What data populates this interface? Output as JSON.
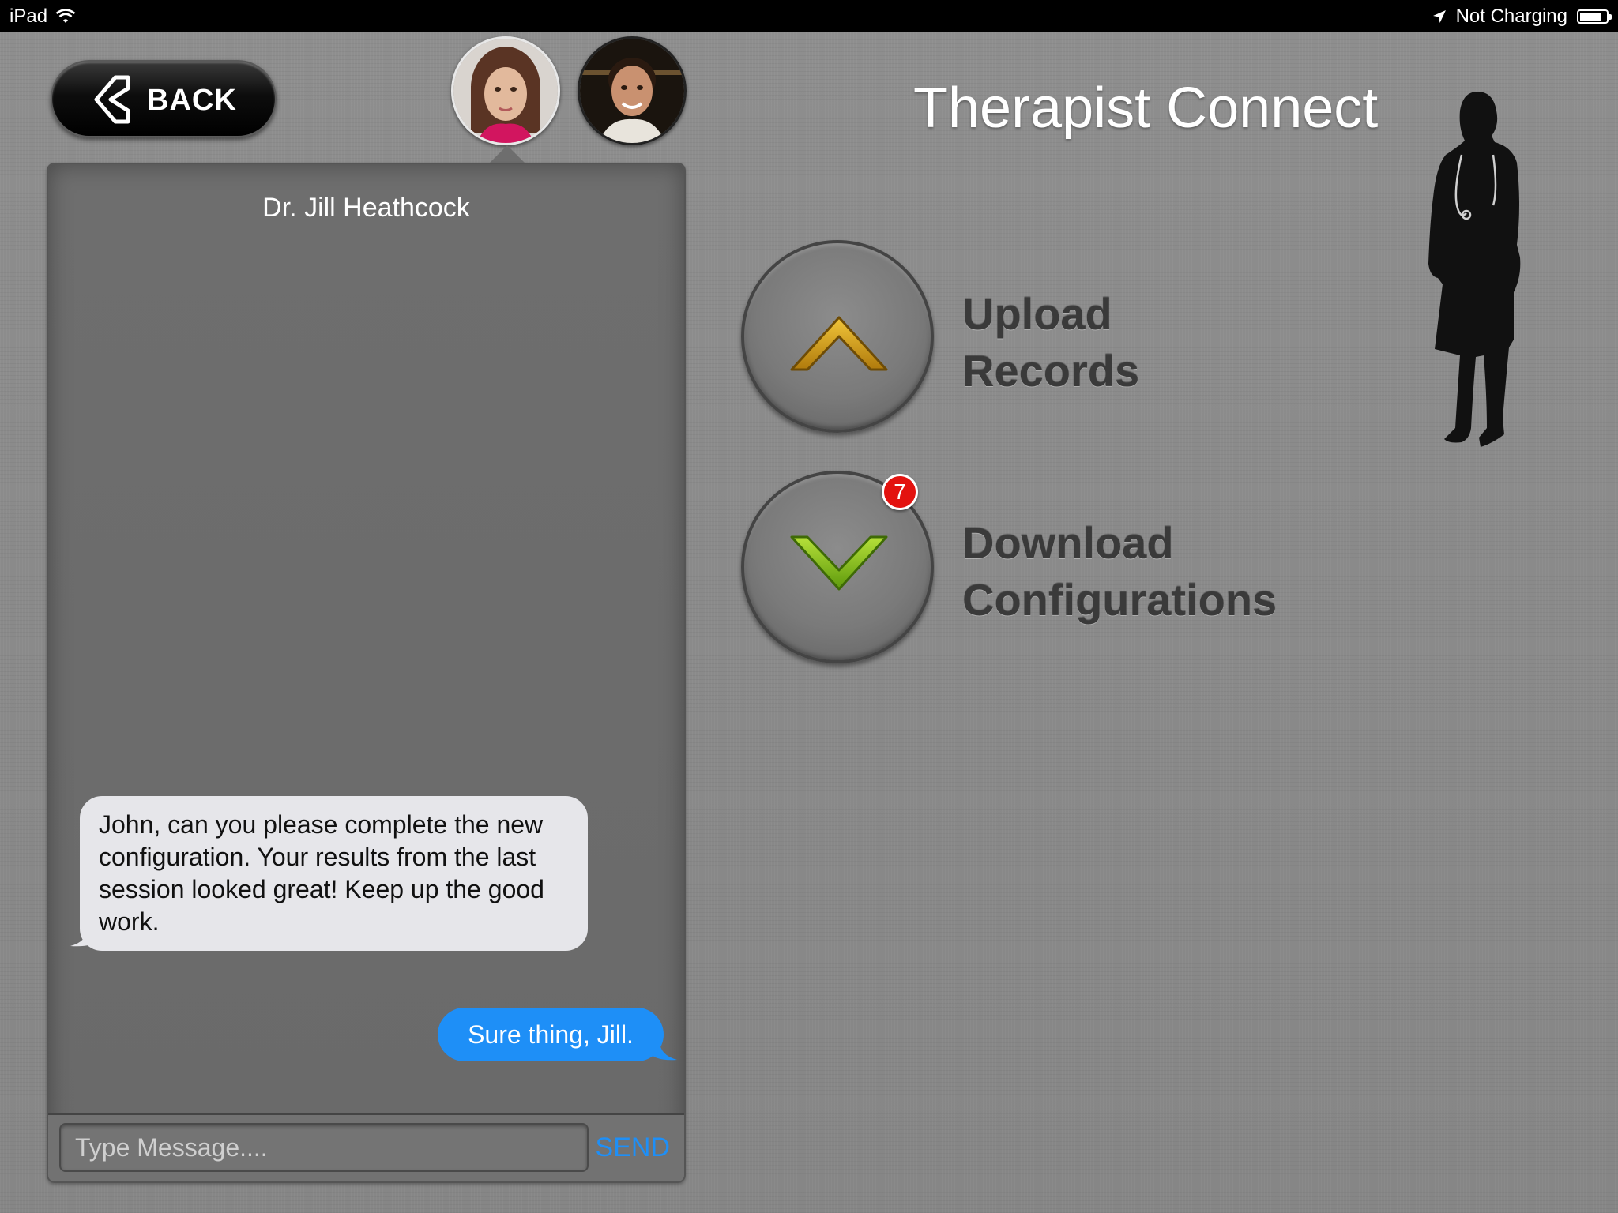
{
  "status_bar": {
    "device": "iPad",
    "power_status": "Not Charging",
    "battery_level": 0.85
  },
  "nav": {
    "back_label": "BACK"
  },
  "app_title": "Therapist Connect",
  "contacts": [
    {
      "id": "jill",
      "selected": true
    },
    {
      "id": "john",
      "selected": false
    }
  ],
  "chat": {
    "contact_name": "Dr. Jill Heathcock",
    "messages": [
      {
        "direction": "incoming",
        "text": "John, can you please complete the new configuration. Your results from the last session looked great! Keep up the good work."
      },
      {
        "direction": "outgoing",
        "text": "Sure thing, Jill."
      }
    ],
    "input_placeholder": "Type Message....",
    "send_label": "SEND"
  },
  "actions": {
    "upload": {
      "line1": "Upload",
      "line2": "Records",
      "icon": "chevron-up-icon",
      "icon_color": "#d9a21a"
    },
    "download": {
      "line1": "Download",
      "line2": "Configurations",
      "icon": "chevron-down-icon",
      "icon_color": "#8cc21e",
      "badge_count": "7"
    }
  },
  "colors": {
    "accent_blue": "#1e8ff7",
    "badge_red": "#e3120f",
    "background_gray": "#8a8a8a"
  }
}
